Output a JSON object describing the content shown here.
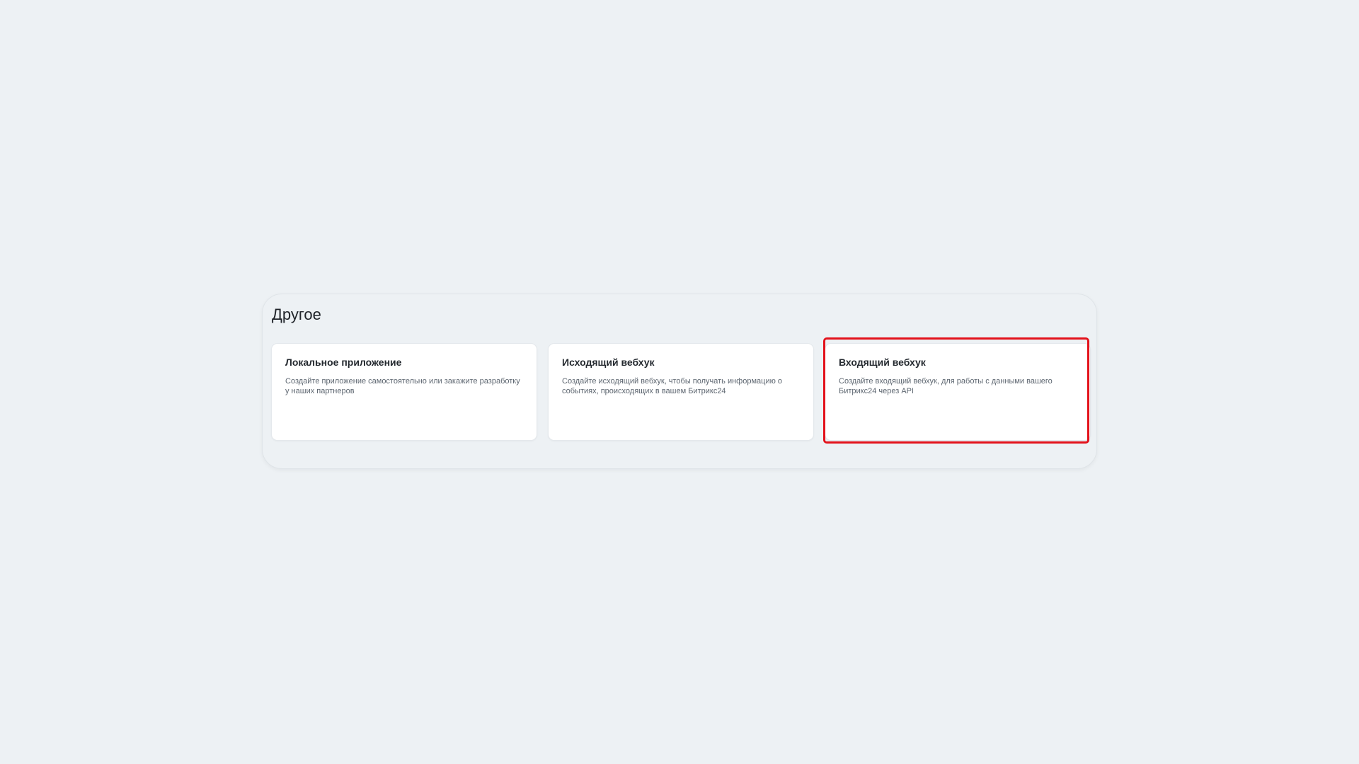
{
  "section": {
    "title": "Другое"
  },
  "cards": [
    {
      "title": "Локальное приложение",
      "description": "Создайте приложение самостоятельно или закажите разработку у наших партнеров"
    },
    {
      "title": "Исходящий вебхук",
      "description": "Создайте исходящий вебхук, чтобы получать информацию о событиях, происходящих в вашем Битрикс24"
    },
    {
      "title": "Входящий вебхук",
      "description": "Создайте входящий вебхук, для работы с данными вашего Битрикс24 через API"
    }
  ],
  "colors": {
    "background": "#edf1f4",
    "card": "#ffffff",
    "highlight": "#e3121b"
  }
}
